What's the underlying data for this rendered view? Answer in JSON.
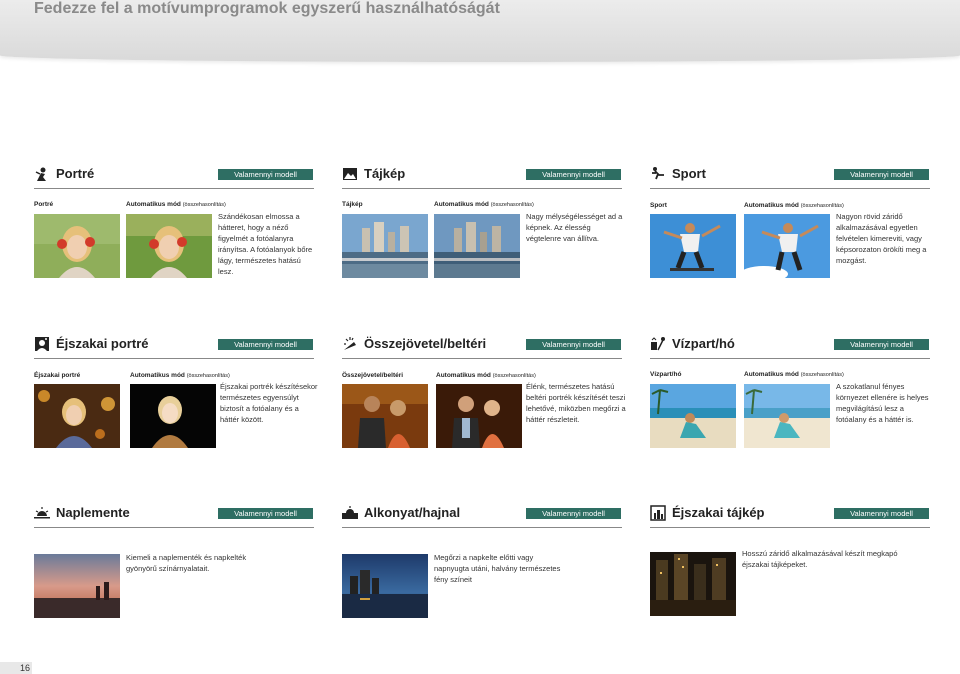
{
  "page": {
    "heading": "Fedezze fel a motívumprogramok egyszerű használhatóságát",
    "page_number": "16"
  },
  "badge_text": "Valamennyi modell",
  "sections": {
    "portre": {
      "title": "Portré",
      "label_left": "Portré",
      "label_auto": "Automatikus mód",
      "label_compare": "(összehasonlítás)",
      "desc": "Szándékosan elmossa a hátteret, hogy a néző figyelmét a fotóalanyra irányítsa. A fotóalanyok bőre lágy, természetes hatású lesz."
    },
    "tajkep": {
      "title": "Tájkép",
      "label_left": "Tájkép",
      "label_auto": "Automatikus mód",
      "label_compare": "(összehasonlítás)",
      "desc": "Nagy mélységélességet ad a képnek. Az élesség végtelenre van állítva."
    },
    "sport": {
      "title": "Sport",
      "label_left": "Sport",
      "label_auto": "Automatikus mód",
      "label_compare": "(összehasonlítás)",
      "desc": "Nagyon rövid záridő alkalmazásával egyetlen felvételen kimereviti, vagy képsorozaton örökíti meg a mozgást."
    },
    "ejszakai_portre": {
      "title": "Éjszakai portré",
      "label_left": "Éjszakai portré",
      "label_auto": "Automatikus mód",
      "label_compare": "(összehasonlítás)",
      "desc": "Éjszakai portrék készítésekor természetes egyensúlyt biztosít a fotóalany és a háttér között."
    },
    "osszejovetel": {
      "title": "Összejövetel/beltéri",
      "label_left": "Összejövetel/beltéri",
      "label_auto": "Automatikus mód",
      "label_compare": "(összehasonlítás)",
      "desc": "Élénk, természetes hatású beltéri portrék készítését teszi lehetővé, miközben megőrzi a háttér részleteit."
    },
    "vizpart": {
      "title": "Vízpart/hó",
      "label_left": "Vízpart/hó",
      "label_auto": "Automatikus mód",
      "label_compare": "(összehasonlítás)",
      "desc": "A szokatlanul fényes környezet ellenére is helyes megvilágítású lesz a fotóalany és a háttér is."
    },
    "naplemente": {
      "title": "Naplemente",
      "desc": "Kiemeli a naplementék és napkelték gyönyörű színárnyalatait."
    },
    "alkonyat": {
      "title": "Alkonyat/hajnal",
      "desc": "Megőrzi a napkelte előtti vagy napnyugta utáni, halvány természetes fény színeit"
    },
    "ejszakai_tajkep": {
      "title": "Éjszakai tájkép",
      "desc": "Hosszú záridő alkalmazásával készít megkapó éjszakai tájképeket."
    }
  },
  "colors": {
    "badge": "#2e6e63",
    "rule": "#888888",
    "heading": "#8a8a8a"
  },
  "icons": [
    "portrait-icon",
    "landscape-icon",
    "sport-icon",
    "night-portrait-icon",
    "party-icon",
    "beach-snow-icon",
    "sunset-icon",
    "dusk-icon",
    "night-landscape-icon"
  ]
}
